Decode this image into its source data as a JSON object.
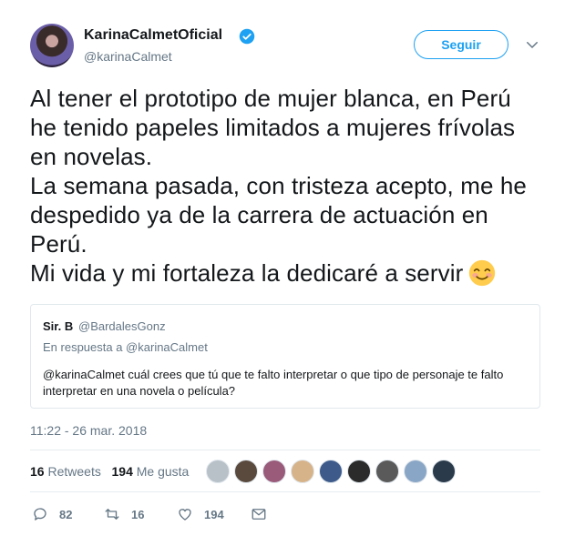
{
  "header": {
    "display_name": "KarinaCalmetOficial",
    "handle": "@karinaCalmet",
    "follow_label": "Seguir"
  },
  "tweet": {
    "line1": "Al tener el prototipo de mujer blanca, en Perú",
    "line2": "he tenido papeles limitados a mujeres frívolas",
    "line3": "en novelas.",
    "line4": "La semana pasada, con tristeza acepto, me he",
    "line5": "despedido ya de la carrera de actuación en",
    "line6": "Perú.",
    "line7": "Mi vida y mi fortaleza la dedicaré a servir",
    "emoji": "smiling-face-emoji"
  },
  "quote": {
    "name": "Sir. B",
    "handle": "@BardalesGonz",
    "reply_to": "En respuesta a @karinaCalmet",
    "text": "@karinaCalmet cuál crees que tú que te falto interpretar o que tipo de personaje te falto interpretar en una novela o película?"
  },
  "timestamp": "11:22 - 26 mar. 2018",
  "stats": {
    "retweets_count": "16",
    "retweets_label": "Retweets",
    "likes_count": "194",
    "likes_label": "Me gusta"
  },
  "actions": {
    "replies": "82",
    "retweets": "16",
    "likes": "194"
  },
  "colors": {
    "accent": "#1da1f2",
    "muted": "#657786",
    "text": "#14171a"
  }
}
